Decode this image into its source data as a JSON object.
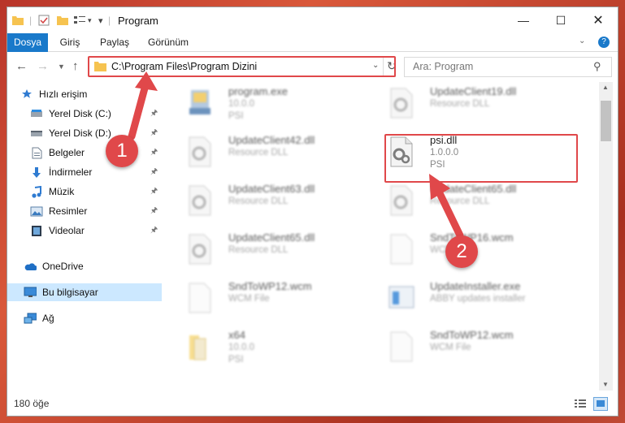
{
  "window": {
    "title": "Program"
  },
  "ribbon": {
    "tabs": [
      "Dosya",
      "Giriş",
      "Paylaş",
      "Görünüm"
    ]
  },
  "nav": {
    "address": "C:\\Program Files\\Program Dizini",
    "search_placeholder": "Ara: Program"
  },
  "sidebar": {
    "items": [
      {
        "label": "Hızlı erişim",
        "icon": "star-icon"
      },
      {
        "label": "Yerel Disk (C:)",
        "icon": "drive-icon",
        "pinned": true
      },
      {
        "label": "Yerel Disk (D:)",
        "icon": "drive-icon",
        "pinned": true
      },
      {
        "label": "Belgeler",
        "icon": "documents-icon",
        "pinned": true
      },
      {
        "label": "İndirmeler",
        "icon": "download-icon",
        "pinned": true
      },
      {
        "label": "Müzik",
        "icon": "music-icon",
        "pinned": true
      },
      {
        "label": "Resimler",
        "icon": "pictures-icon",
        "pinned": true
      },
      {
        "label": "Videolar",
        "icon": "video-icon",
        "pinned": true
      },
      {
        "label": "OneDrive",
        "icon": "cloud-icon"
      },
      {
        "label": "Bu bilgisayar",
        "icon": "computer-icon",
        "selected": true
      },
      {
        "label": "Ağ",
        "icon": "network-icon"
      }
    ]
  },
  "files": [
    {
      "name": "program.exe",
      "line1": "10.0.0",
      "line2": "PSI",
      "icon": "exe-icon"
    },
    {
      "name": "UpdateClient19.dll",
      "line1": "Resource DLL",
      "line2": "",
      "icon": "dll-icon"
    },
    {
      "name": "UpdateClient42.dll",
      "line1": "Resource DLL",
      "line2": "",
      "icon": "dll-icon"
    },
    {
      "name": "psi.dll",
      "line1": "1.0.0.0",
      "line2": "PSI",
      "icon": "dll-icon"
    },
    {
      "name": "UpdateClient63.dll",
      "line1": "Resource DLL",
      "line2": "",
      "icon": "dll-icon"
    },
    {
      "name": "UpdateClient65.dll",
      "line1": "Resource DLL",
      "line2": "",
      "icon": "dll-icon"
    },
    {
      "name": "UpdateClient65.dll",
      "line1": "Resource DLL",
      "line2": "",
      "icon": "dll-icon"
    },
    {
      "name": "SndToWP16.wcm",
      "line1": "WCM File",
      "line2": "",
      "icon": "file-icon"
    },
    {
      "name": "SndToWP12.wcm",
      "line1": "WCM File",
      "line2": "",
      "icon": "file-icon"
    },
    {
      "name": "UpdateInstaller.exe",
      "line1": "ABBY updates installer",
      "line2": "",
      "icon": "installer-icon"
    },
    {
      "name": "x64",
      "line1": "10.0.0",
      "line2": "PSI",
      "icon": "folder-icon"
    },
    {
      "name": "SndToWP12.wcm",
      "line1": "WCM File",
      "line2": "",
      "icon": "file-icon"
    }
  ],
  "status": {
    "item_count": "180 öğe"
  },
  "markers": {
    "one": "1",
    "two": "2"
  },
  "colors": {
    "accent": "#1979ca",
    "highlight": "#e0484a",
    "selected": "#cce8ff"
  }
}
